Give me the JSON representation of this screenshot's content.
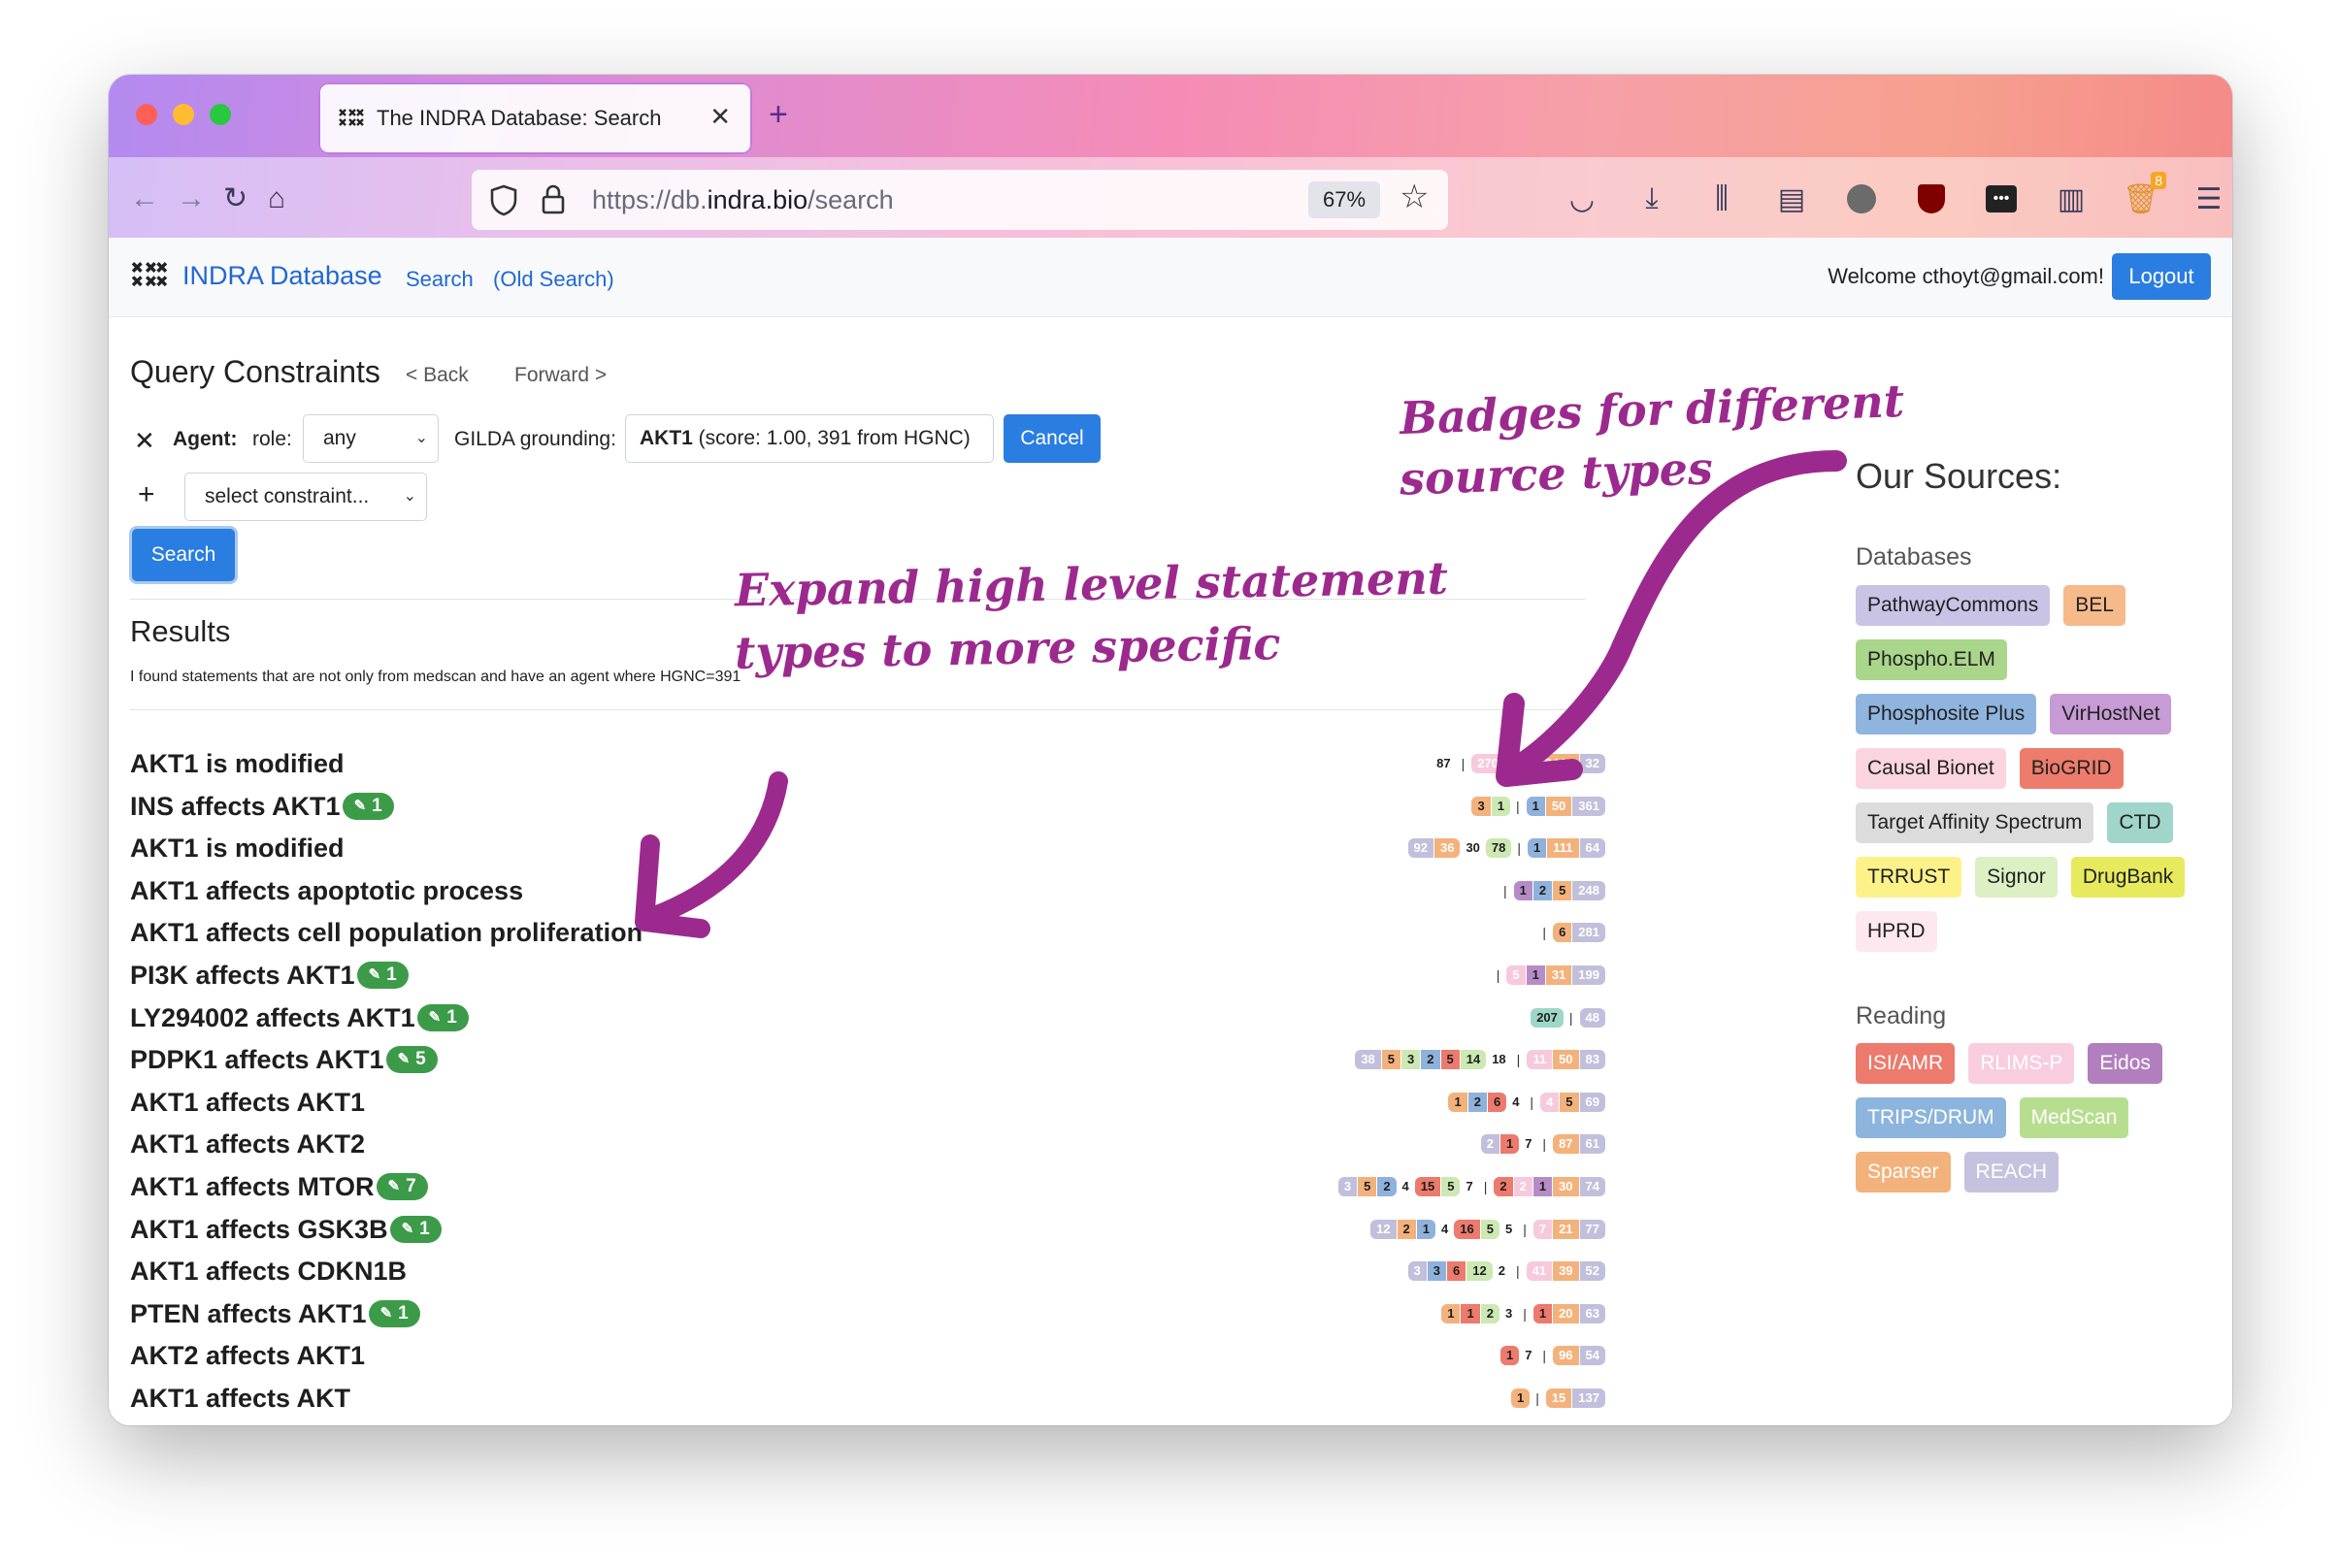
{
  "browser": {
    "tab_title": "The INDRA Database: Search",
    "url_prefix": "https://db.",
    "url_domain": "indra.bio",
    "url_path": "/search",
    "zoom": "67%",
    "ext_badge_count": "8"
  },
  "navbar": {
    "brand": "INDRA Database",
    "search_link": "Search",
    "old_search_link": "(Old Search)",
    "welcome": "Welcome cthoyt@gmail.com!",
    "logout": "Logout"
  },
  "query": {
    "heading": "Query Constraints",
    "back": "< Back",
    "forward": "Forward >",
    "agent_label": "Agent:",
    "role_label": "role:",
    "role_value": "any",
    "gilda_label": "GILDA grounding:",
    "grounding_name": "AKT1",
    "grounding_detail": " (score: 1.00, 391 from HGNC)",
    "cancel": "Cancel",
    "constraint_placeholder": "select constraint...",
    "search_button": "Search"
  },
  "results": {
    "heading": "Results",
    "description": "I found statements that are not only from medscan and have an agent where HGNC=391",
    "statements": [
      {
        "text": "AKT1 is modified",
        "expand": "",
        "badges": [
          [
            "87",
            "plain"
          ],
          "|",
          [
            "2702",
            "pink"
          ],
          [
            "50",
            "blue"
          ],
          [
            "2449",
            "orange"
          ],
          [
            "32",
            "lavender"
          ]
        ]
      },
      {
        "text": "INS affects AKT1",
        "expand": "1",
        "badges": [
          [
            "3",
            "orange"
          ],
          [
            "1",
            "green"
          ],
          "|",
          [
            "1",
            "blue"
          ],
          [
            "50",
            "orange"
          ],
          [
            "361",
            "lavender"
          ]
        ]
      },
      {
        "text": "AKT1 is modified",
        "expand": "",
        "badges": [
          [
            "92",
            "lavender"
          ],
          [
            "36",
            "orange"
          ],
          [
            "30",
            "plain"
          ],
          [
            "78",
            "green"
          ],
          "|",
          [
            "1",
            "blue"
          ],
          [
            "111",
            "orange"
          ],
          [
            "64",
            "lavender"
          ]
        ]
      },
      {
        "text": "AKT1 affects apoptotic process",
        "expand": "",
        "badges": [
          "|",
          [
            "1",
            "purple"
          ],
          [
            "2",
            "blue"
          ],
          [
            "5",
            "orange"
          ],
          [
            "248",
            "lavender"
          ]
        ]
      },
      {
        "text": "AKT1 affects cell population proliferation",
        "expand": "",
        "badges": [
          "|",
          [
            "6",
            "orange"
          ],
          [
            "281",
            "lavender"
          ]
        ]
      },
      {
        "text": "PI3K affects AKT1",
        "expand": "1",
        "badges": [
          "|",
          [
            "5",
            "pink"
          ],
          [
            "1",
            "purple"
          ],
          [
            "31",
            "orange"
          ],
          [
            "199",
            "lavender"
          ]
        ]
      },
      {
        "text": "LY294002 affects AKT1",
        "expand": "1",
        "badges": [
          [
            "207",
            "teal"
          ],
          "|",
          [
            "48",
            "lavender"
          ]
        ]
      },
      {
        "text": "PDPK1 affects AKT1",
        "expand": "5",
        "badges": [
          [
            "38",
            "lavender"
          ],
          [
            "5",
            "orange"
          ],
          [
            "3",
            "green"
          ],
          [
            "2",
            "blue"
          ],
          [
            "5",
            "red"
          ],
          [
            "14",
            "green"
          ],
          [
            "18",
            "plain"
          ],
          "|",
          [
            "11",
            "pink"
          ],
          [
            "50",
            "orange"
          ],
          [
            "83",
            "lavender"
          ]
        ]
      },
      {
        "text": "AKT1 affects AKT1",
        "expand": "",
        "badges": [
          [
            "1",
            "orange"
          ],
          [
            "2",
            "blue"
          ],
          [
            "6",
            "red"
          ],
          [
            "4",
            "plain"
          ],
          "|",
          [
            "4",
            "pink"
          ],
          [
            "5",
            "orange"
          ],
          [
            "69",
            "lavender"
          ]
        ]
      },
      {
        "text": "AKT1 affects AKT2",
        "expand": "",
        "badges": [
          [
            "2",
            "lavender"
          ],
          [
            "1",
            "red"
          ],
          [
            "7",
            "plain"
          ],
          "|",
          [
            "87",
            "orange"
          ],
          [
            "61",
            "lavender"
          ]
        ]
      },
      {
        "text": "AKT1 affects MTOR",
        "expand": "7",
        "badges": [
          [
            "3",
            "lavender"
          ],
          [
            "5",
            "orange"
          ],
          [
            "2",
            "blue"
          ],
          [
            "4",
            "plain"
          ],
          [
            "15",
            "red"
          ],
          [
            "5",
            "green"
          ],
          [
            "7",
            "plain"
          ],
          "|",
          [
            "2",
            "red"
          ],
          [
            "2",
            "pink"
          ],
          [
            "1",
            "purple"
          ],
          [
            "30",
            "orange"
          ],
          [
            "74",
            "lavender"
          ]
        ]
      },
      {
        "text": "AKT1 affects GSK3B",
        "expand": "1",
        "badges": [
          [
            "12",
            "lavender"
          ],
          [
            "2",
            "orange"
          ],
          [
            "1",
            "blue"
          ],
          [
            "4",
            "plain"
          ],
          [
            "16",
            "red"
          ],
          [
            "5",
            "green"
          ],
          [
            "5",
            "plain"
          ],
          "|",
          [
            "7",
            "pink"
          ],
          [
            "21",
            "orange"
          ],
          [
            "77",
            "lavender"
          ]
        ]
      },
      {
        "text": "AKT1 affects CDKN1B",
        "expand": "",
        "badges": [
          [
            "3",
            "lavender"
          ],
          [
            "3",
            "blue"
          ],
          [
            "6",
            "red"
          ],
          [
            "12",
            "green"
          ],
          [
            "2",
            "plain"
          ],
          "|",
          [
            "41",
            "pink"
          ],
          [
            "39",
            "orange"
          ],
          [
            "52",
            "lavender"
          ]
        ]
      },
      {
        "text": "PTEN affects AKT1",
        "expand": "1",
        "badges": [
          [
            "1",
            "orange"
          ],
          [
            "1",
            "red"
          ],
          [
            "2",
            "green"
          ],
          [
            "3",
            "plain"
          ],
          "|",
          [
            "1",
            "red"
          ],
          [
            "20",
            "orange"
          ],
          [
            "63",
            "lavender"
          ]
        ]
      },
      {
        "text": "AKT2 affects AKT1",
        "expand": "",
        "badges": [
          [
            "1",
            "red"
          ],
          [
            "7",
            "plain"
          ],
          "|",
          [
            "96",
            "orange"
          ],
          [
            "54",
            "lavender"
          ]
        ]
      },
      {
        "text": "AKT1 affects AKT",
        "expand": "",
        "badges": [
          [
            "1",
            "orange"
          ],
          "|",
          [
            "15",
            "orange"
          ],
          [
            "137",
            "lavender"
          ]
        ]
      }
    ]
  },
  "annotations": {
    "badges_line1": "Badges for different",
    "badges_line2": "source types",
    "expand_line1": "Expand high level statement",
    "expand_line2": "types to more specific"
  },
  "sources": {
    "title": "Our Sources:",
    "databases_heading": "Databases",
    "databases": [
      {
        "label": "PathwayCommons",
        "color": "#c9c3e6"
      },
      {
        "label": "BEL",
        "color": "#f5b98a"
      },
      {
        "label": "Phospho.ELM",
        "color": "#a9d68b"
      },
      {
        "label": "Phosphosite Plus",
        "color": "#8fb5df"
      },
      {
        "label": "VirHostNet",
        "color": "#c79bd5"
      },
      {
        "label": "Causal Bionet",
        "color": "#fad4df"
      },
      {
        "label": "BioGRID",
        "color": "#ee7c6c"
      },
      {
        "label": "Target Affinity Spectrum",
        "color": "#dcdcdc"
      },
      {
        "label": "CTD",
        "color": "#9fd6c9"
      },
      {
        "label": "TRRUST",
        "color": "#fdf28a"
      },
      {
        "label": "Signor",
        "color": "#dcf0c4"
      },
      {
        "label": "DrugBank",
        "color": "#e6ea5c"
      },
      {
        "label": "HPRD",
        "color": "#fde8ef"
      }
    ],
    "reading_heading": "Reading",
    "reading": [
      {
        "label": "ISI/AMR",
        "color": "#ec7a6d"
      },
      {
        "label": "RLIMS-P",
        "color": "#f9cde0"
      },
      {
        "label": "Eidos",
        "color": "#b17fbd"
      },
      {
        "label": "TRIPS/DRUM",
        "color": "#8cb4dc"
      },
      {
        "label": "MedScan",
        "color": "#b7de8f"
      },
      {
        "label": "Sparser",
        "color": "#f3b27c"
      },
      {
        "label": "REACH",
        "color": "#c5c2df"
      }
    ]
  },
  "badge_colors": {
    "pink": "#f7c9dc",
    "blue": "#8fb2dc",
    "orange": "#f3b27c",
    "lavender": "#c2bfdc",
    "green": "#cce8b3",
    "purple": "#b68cc8",
    "teal": "#9ed7c7",
    "red": "#ec7a6d"
  }
}
